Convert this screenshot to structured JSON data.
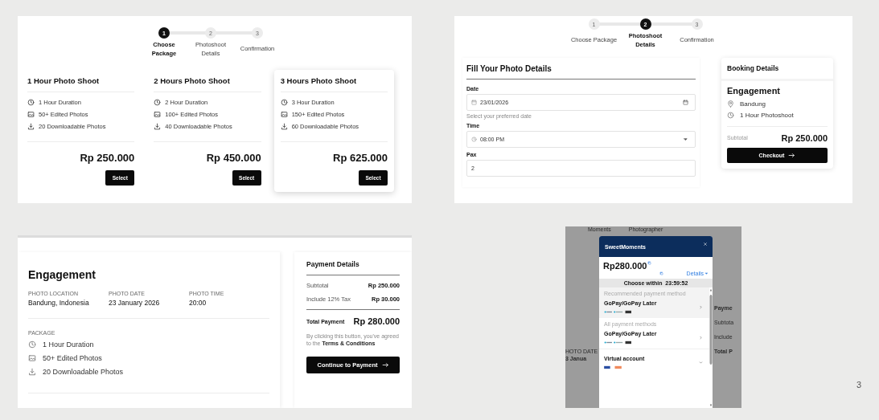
{
  "package_screen": {
    "steps": [
      {
        "number": "1",
        "label": "Choose Package",
        "selected": true
      },
      {
        "number": "2",
        "label": "Photoshoot Details",
        "selected": false
      },
      {
        "number": "3",
        "label": "Confirmation",
        "selected": false
      }
    ],
    "packages": [
      {
        "title": "1 Hour Photo Shoot",
        "features": [
          {
            "kind": "duration",
            "text": "1 Hour Duration"
          },
          {
            "kind": "photos",
            "text": "50+ Edited Photos"
          },
          {
            "kind": "download",
            "text": "20 Downloadable Photos"
          }
        ],
        "price": "Rp 250.000",
        "button": "Select",
        "selected": false
      },
      {
        "title": "2 Hours Photo Shoot",
        "features": [
          {
            "kind": "duration",
            "text": "2 Hour Duration"
          },
          {
            "kind": "photos",
            "text": "100+ Edited Photos"
          },
          {
            "kind": "download",
            "text": "40 Downloadable Photos"
          }
        ],
        "price": "Rp 450.000",
        "button": "Select",
        "selected": false
      },
      {
        "title": "3 Hours Photo Shoot",
        "features": [
          {
            "kind": "duration",
            "text": "3 Hour Duration"
          },
          {
            "kind": "photos",
            "text": "150+ Edited Photos"
          },
          {
            "kind": "download",
            "text": "60 Downloadable Photos"
          }
        ],
        "price": "Rp 625.000",
        "button": "Select",
        "selected": true
      }
    ]
  },
  "details_screen": {
    "steps": [
      {
        "number": "1",
        "label": "Choose Package",
        "selected": false
      },
      {
        "number": "2",
        "label": "Photoshoot Details",
        "selected": true
      },
      {
        "number": "3",
        "label": "Confirmation",
        "selected": false
      }
    ],
    "form": {
      "title": "Fill Your Photo Details",
      "fields": [
        {
          "kind": "date",
          "label": "Date",
          "value": "23/01/2026",
          "hint": "Select your preferred date"
        },
        {
          "kind": "time",
          "label": "Time",
          "value": "08:00 PM"
        },
        {
          "kind": "number",
          "label": "Pax",
          "value": "2"
        }
      ]
    },
    "booking": {
      "title": "Booking Details",
      "event": "Engagement",
      "items": [
        {
          "kind": "location",
          "text": "Bandung"
        },
        {
          "kind": "duration",
          "text": "1 Hour Photoshoot"
        }
      ],
      "subtotal_label": "Subtotal",
      "subtotal": "Rp 250.000",
      "button": "Checkout"
    }
  },
  "confirmation_screen": {
    "event": "Engagement",
    "info": [
      {
        "label": "PHOTO LOCATION",
        "value": "Bandung, Indonesia"
      },
      {
        "label": "PHOTO DATE",
        "value": "23 January 2026"
      },
      {
        "label": "PHOTO TIME",
        "value": "20:00"
      }
    ],
    "package_label": "PACKAGE",
    "features": [
      {
        "kind": "duration",
        "text": "1 Hour Duration"
      },
      {
        "kind": "photos",
        "text": "50+ Edited Photos"
      },
      {
        "kind": "download",
        "text": "20 Downloadable Photos"
      }
    ],
    "payment": {
      "title": "Payment Details",
      "rows": [
        {
          "label": "Subtotal",
          "value": "Rp 250.000"
        },
        {
          "label": "Include 12% Tax",
          "value": "Rp 30.000"
        }
      ],
      "total_label": "Total Payment",
      "total": "Rp 280.000",
      "note": "By clicking this button, you've agreed to the **Terms & Conditions**",
      "button": "Continue to Payment"
    }
  },
  "payment_screen": {
    "background": {
      "nav": [
        "Moments",
        "Photographer"
      ],
      "left": [
        "HOTO DATE",
        "3 Janua"
      ],
      "right": [
        "Payme",
        "Subtota",
        "Include",
        "Total P"
      ]
    },
    "modal": {
      "brand": "SweetMoments",
      "amount": "Rp280.000",
      "details_link": "Details",
      "timer": "Choose within  23:59:52",
      "sections": [
        {
          "heading": "Recommended payment method",
          "highlighted": true,
          "methods": [
            {
              "name": "GoPay/GoPay Later",
              "kind": "link"
            }
          ]
        },
        {
          "heading": "All payment methods",
          "highlighted": false,
          "methods": [
            {
              "name": "GoPay/GoPay Later",
              "kind": "link"
            },
            {
              "name": "Virtual account",
              "kind": "expand"
            }
          ]
        }
      ]
    }
  },
  "slide_number": "3"
}
